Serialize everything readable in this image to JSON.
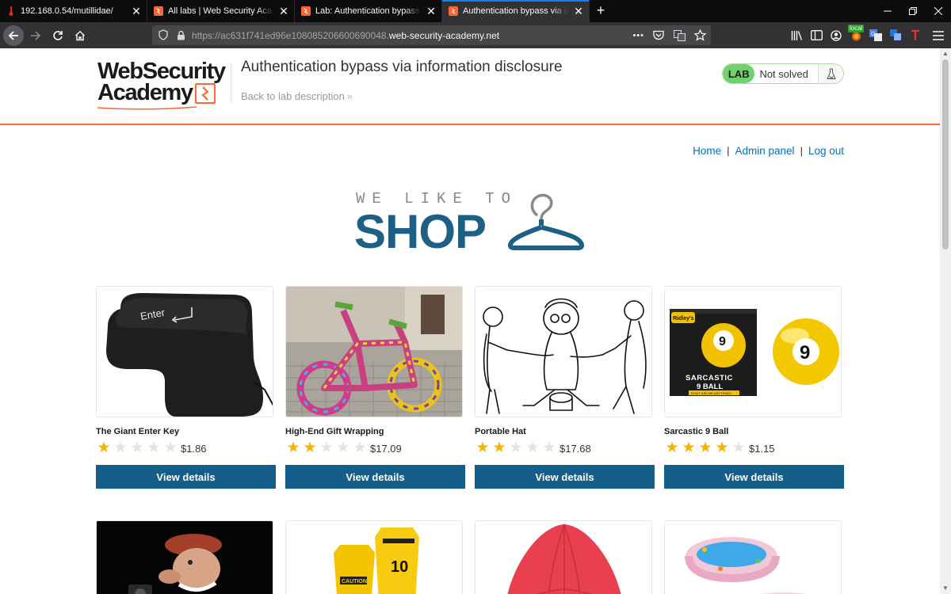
{
  "browser": {
    "tabs": [
      {
        "title": "192.168.0.54/mutillidae/",
        "favicon": "thermometer-icon"
      },
      {
        "title": "All labs | Web Security Academy",
        "favicon": "wsa-icon"
      },
      {
        "title": "Lab: Authentication bypass via",
        "favicon": "wsa-icon"
      },
      {
        "title": "Authentication bypass via information",
        "favicon": "wsa-icon",
        "active": true
      }
    ],
    "new_tab": "+",
    "url_prefix": "https://ac631f741ed96e108085206600690048.",
    "url_domain": "web-security-academy.net",
    "url_more": "•••",
    "extension_badge": "local"
  },
  "header": {
    "logo_line1": "WebSecurity",
    "logo_line2": "Academy",
    "lab_title": "Authentication bypass via information disclosure",
    "back_link": "Back to lab description",
    "back_chevron": "»",
    "lab_badge": "LAB",
    "lab_status": "Not solved"
  },
  "nav": {
    "home": "Home",
    "admin": "Admin panel",
    "logout": "Log out",
    "separator": "|"
  },
  "banner": {
    "top": "WE LIKE TO",
    "main": "SHOP"
  },
  "products": [
    {
      "name": "The Giant Enter Key",
      "price": "$1.86",
      "rating": 1,
      "button": "View details",
      "image": "enter-key-image"
    },
    {
      "name": "High-End Gift Wrapping",
      "price": "$17.09",
      "rating": 2,
      "button": "View details",
      "image": "gift-wrapped-bicycle-image"
    },
    {
      "name": "Portable Hat",
      "price": "$17.68",
      "rating": 2,
      "button": "View details",
      "image": "portable-hat-drawing-image"
    },
    {
      "name": "Sarcastic 9 Ball",
      "price": "$1.15",
      "rating": 4,
      "button": "View details",
      "image": "sarcastic-9-ball-image"
    }
  ],
  "product_images_row2": [
    "photographer-figurine-image",
    "caution-signs-image",
    "red-umbrella-image",
    "inflatable-pool-image"
  ],
  "nine_ball": {
    "number": "9",
    "brand": "Ridley's",
    "box_line1": "SARCASTIC",
    "box_line2": "9 BALL",
    "box_tag": "DON'T ASK ME ANYTHING!"
  },
  "enter_key_label": "Enter",
  "caution_sign": {
    "word": "CAUTION",
    "number": "10"
  },
  "colors": {
    "accent": "#ff6633",
    "link": "#0071bc",
    "button": "#155d8a",
    "shop_blue": "#1d5f85",
    "star": "#f5b301",
    "lab_green": "#70d16d"
  }
}
